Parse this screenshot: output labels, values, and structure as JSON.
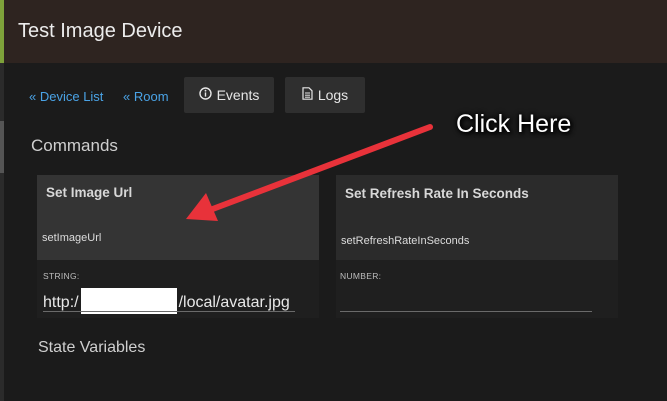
{
  "window": {
    "title": "Test Image Device"
  },
  "nav": {
    "device_list": "« Device List",
    "room": "« Room",
    "events": "Events",
    "logs": "Logs"
  },
  "sections": {
    "commands": "Commands",
    "state_variables": "State Variables"
  },
  "commands": [
    {
      "name": "Set Image Url",
      "command": "setImageUrl",
      "arg_type": "STRING:",
      "arg_prefix": "http:/",
      "arg_suffix": "/local/avatar.jpg"
    },
    {
      "name": "Set Refresh Rate In Seconds",
      "command": "setRefreshRateInSeconds",
      "arg_type": "NUMBER:",
      "arg_value": ""
    }
  ],
  "annotation": {
    "callout_text": "Click Here",
    "arrow_color": "#e8323a"
  },
  "colors": {
    "accent": "#7ea23a",
    "link": "#4aa3e6",
    "background": "#1b1b1b"
  }
}
